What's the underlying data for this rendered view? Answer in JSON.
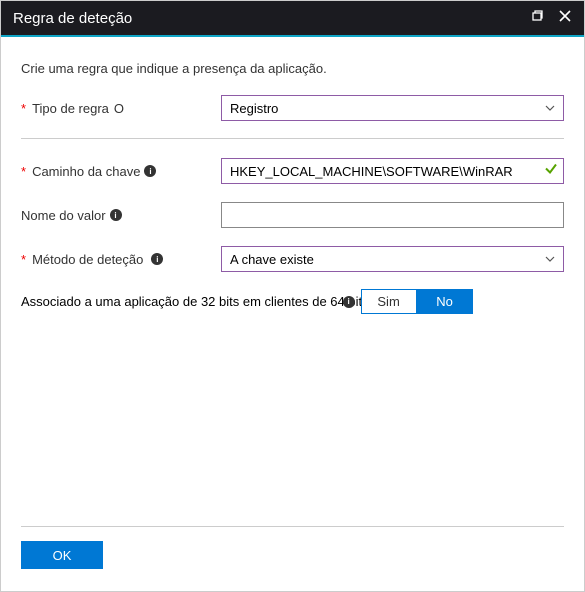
{
  "header": {
    "title": "Regra de deteção"
  },
  "intro": "Crie uma regra que indique a presença da aplicação.",
  "fields": {
    "ruleType": {
      "label": "Tipo de regra",
      "help": "O",
      "value": "Registro"
    },
    "keyPath": {
      "label": "Caminho da chave",
      "value": "HKEY_LOCAL_MACHINE\\SOFTWARE\\WinRAR"
    },
    "valueName": {
      "label": "Nome do valor",
      "value": ""
    },
    "detectMethod": {
      "label": "Método de deteção",
      "value": "A chave existe"
    },
    "assoc": {
      "label": "Associado a uma aplicação de 32 bits em clientes de 64 bits",
      "yes": "Sim",
      "no": "No"
    }
  },
  "footer": {
    "ok": "OK"
  }
}
